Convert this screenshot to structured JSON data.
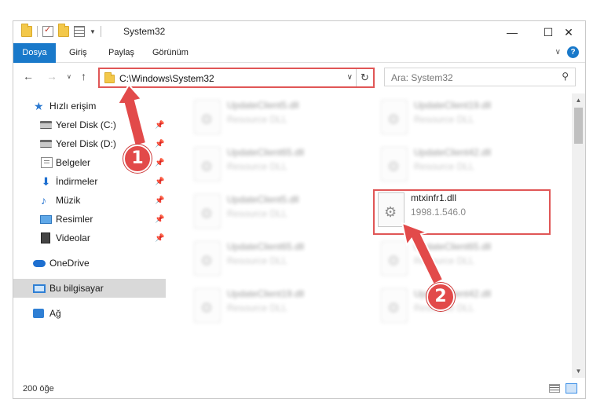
{
  "window": {
    "title": "System32"
  },
  "ribbon": {
    "tabs": [
      "Dosya",
      "Giriş",
      "Paylaş",
      "Görünüm"
    ],
    "help": "?"
  },
  "nav": {
    "path": "C:\\Windows\\System32",
    "search_placeholder": "Ara: System32"
  },
  "sidebar": {
    "items": [
      {
        "label": "Hızlı erişim",
        "icon": "star-icon",
        "pinned": false
      },
      {
        "label": "Yerel Disk (C:)",
        "icon": "drive-icon",
        "pinned": true
      },
      {
        "label": "Yerel Disk (D:)",
        "icon": "drive-icon",
        "pinned": true
      },
      {
        "label": "Belgeler",
        "icon": "documents-icon",
        "pinned": true
      },
      {
        "label": "İndirmeler",
        "icon": "download-icon",
        "pinned": true
      },
      {
        "label": "Müzik",
        "icon": "music-icon",
        "pinned": true
      },
      {
        "label": "Resimler",
        "icon": "pictures-icon",
        "pinned": true
      },
      {
        "label": "Videolar",
        "icon": "videos-icon",
        "pinned": true
      },
      {
        "label": "OneDrive",
        "icon": "cloud-icon",
        "pinned": false
      },
      {
        "label": "Bu bilgisayar",
        "icon": "computer-icon",
        "pinned": false,
        "selected": true
      },
      {
        "label": "Ağ",
        "icon": "network-icon",
        "pinned": false
      }
    ]
  },
  "files": [
    {
      "name": "UpdateClient5.dll",
      "type": "Resource DLL",
      "blurred": true
    },
    {
      "name": "UpdateClient19.dll",
      "type": "Resource DLL",
      "blurred": true
    },
    {
      "name": "UpdateClient65.dll",
      "type": "Resource DLL",
      "blurred": true
    },
    {
      "name": "UpdateClient42.dll",
      "type": "Resource DLL",
      "blurred": true
    },
    {
      "name": "UpdateClient5.dll",
      "type": "Resource DLL",
      "blurred": true
    },
    {
      "name": "mtxinfr1.dll",
      "type": "1998.1.546.0",
      "blurred": false,
      "highlighted": true
    },
    {
      "name": "UpdateClient65.dll",
      "type": "Resource DLL",
      "blurred": true
    },
    {
      "name": "UpdateClient65.dll",
      "type": "Resource DLL",
      "blurred": true
    },
    {
      "name": "UpdateClient19.dll",
      "type": "Resource DLL",
      "blurred": true
    },
    {
      "name": "UpdateClient42.dll",
      "type": "Resource DLL",
      "blurred": true
    }
  ],
  "status": {
    "count": "200 öğe"
  },
  "annotations": {
    "step1": "1",
    "step2": "2",
    "color": "#e24a4a"
  }
}
